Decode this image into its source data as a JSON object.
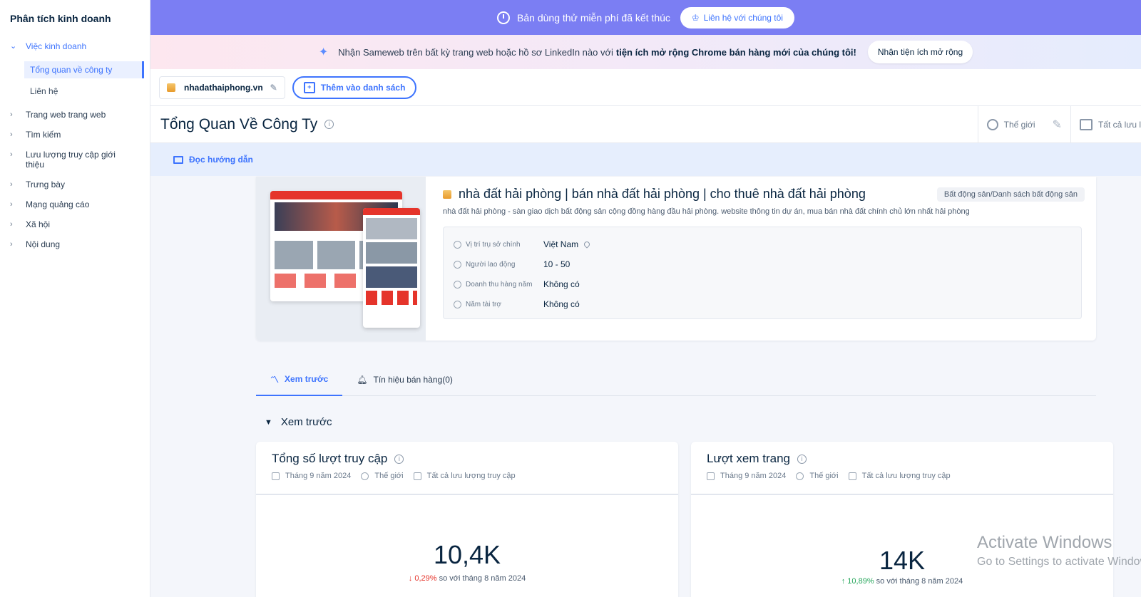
{
  "sidebar": {
    "title": "Phân tích kinh doanh",
    "open_section": "Việc kinh doanh",
    "sub_items": [
      "Tổng quan về công ty",
      "Liên hệ"
    ],
    "items": [
      "Trang web trang web",
      "Tìm kiếm",
      "Lưu lượng truy cập giới thiệu",
      "Trưng bày",
      "Mạng quảng cáo",
      "Xã hội",
      "Nội dung"
    ]
  },
  "trial": {
    "text": "Bản dùng thử miễn phí đã kết thúc",
    "button": "Liên hệ với chúng tôi"
  },
  "promo": {
    "text": "Nhận Sameweb trên bất kỳ trang web hoặc hồ sơ LinkedIn nào với",
    "bold": "tiện ích mở rộng Chrome bán hàng mới của chúng tôi!",
    "button": "Nhận tiện ích mở rộng"
  },
  "domain": {
    "name": "nhadathaiphong.vn",
    "add_list": "Thêm vào danh sách"
  },
  "header": {
    "title": "Tổng Quan Về Công Ty",
    "region": "Thế giới",
    "traffic": "Tất cả lưu l"
  },
  "guide": {
    "label": "Đọc hướng dẫn"
  },
  "company": {
    "name": "nhà đất hải phòng | bán nhà đất hải phòng | cho thuê nhà đất hải phòng",
    "category": "Bất động sản/Danh sách bất động sản",
    "description": "nhà đất hải phòng - sàn giao dịch bất động sản cộng đồng hàng đầu hải phòng. website thông tin dự án, mua bán nhà đất chính chủ lớn nhất hải phòng",
    "info": [
      {
        "label": "Vị trí trụ sở chính",
        "value": "Việt Nam"
      },
      {
        "label": "Người lao động",
        "value": "10 - 50"
      },
      {
        "label": "Doanh thu hàng năm",
        "value": "Không có"
      },
      {
        "label": "Năm tài trợ",
        "value": "Không có"
      }
    ]
  },
  "tabs": [
    {
      "label": "Xem trước",
      "icon": "chart-line-icon"
    },
    {
      "label": "Tín hiệu bán hàng(0)",
      "icon": "bell-icon"
    }
  ],
  "section": {
    "title": "Xem trước"
  },
  "metrics": [
    {
      "title": "Tổng số lượt truy cập",
      "period": "Tháng 9 năm 2024",
      "region": "Thế giới",
      "traffic": "Tất cả lưu lượng truy cập",
      "value": "10,4K",
      "change": "0,29%",
      "direction": "down",
      "compare": "so với tháng 8 năm 2024"
    },
    {
      "title": "Lượt xem trang",
      "period": "Tháng 9 năm 2024",
      "region": "Thế giới",
      "traffic": "Tất cả lưu lượng truy cập",
      "value": "14K",
      "change": "10,89%",
      "direction": "up",
      "compare": "so với tháng 8 năm 2024"
    }
  ],
  "watermark": {
    "line1": "Activate Windows",
    "line2": "Go to Settings to activate Windows."
  },
  "colors": {
    "accent": "#3e74fe",
    "trial_bar": "#7b7ef3",
    "down": "#e5342b",
    "up": "#26a65b"
  }
}
